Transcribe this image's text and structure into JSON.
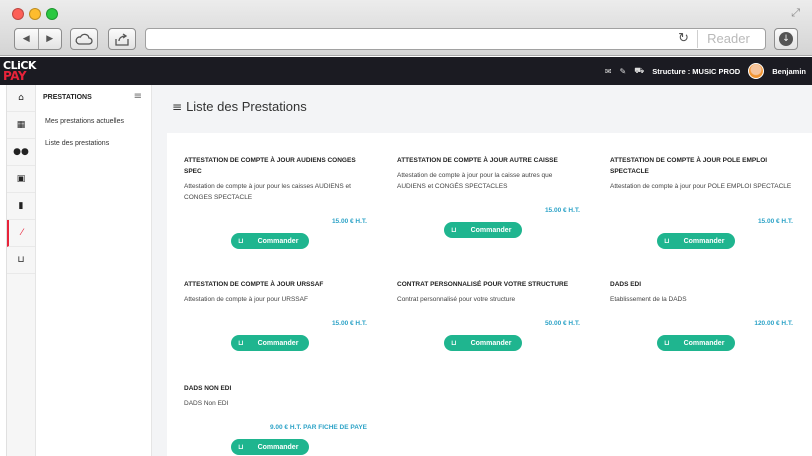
{
  "browser": {
    "reader_label": "Reader",
    "icons": [
      "back-icon",
      "forward-icon",
      "cloud-icon",
      "share-icon",
      "reload-icon",
      "download-icon",
      "fullscreen-icon"
    ]
  },
  "app": {
    "logo_line1": "CLiCK",
    "logo_line2": "PAY",
    "structure_label": "Structure : MUSIC PROD",
    "user_name": "Benjamin",
    "accent_color": "#e8233a",
    "button_color": "#1fb58f",
    "price_color": "#2da3c7"
  },
  "rail": {
    "items": [
      "home-icon",
      "calculator-icon",
      "users-icon",
      "money-icon",
      "document-icon",
      "wand-icon",
      "cart-icon"
    ]
  },
  "submenu": {
    "title": "PRESTATIONS",
    "items": [
      {
        "label": "Mes prestations actuelles"
      },
      {
        "label": "Liste des prestations"
      }
    ]
  },
  "main": {
    "title": "Liste des Prestations",
    "button_label": "Commander",
    "cards": [
      {
        "title": "ATTESTATION DE COMPTE À JOUR AUDIENS CONGES SPEC",
        "desc": "Attestation de compte à jour pour les caisses AUDIENS et CONGES SPECTACLE",
        "price": "15.00 € H.T."
      },
      {
        "title": "ATTESTATION DE COMPTE À JOUR AUTRE CAISSE",
        "desc": "Attestation de compte à jour pour la caisse autres que AUDIENS et CONGÉS SPECTACLES",
        "price": "15.00 € H.T."
      },
      {
        "title": "ATTESTATION DE COMPTE À JOUR POLE EMPLOI SPECTACLE",
        "desc": "Attestation de compte à jour pour POLE EMPLOI SPECTACLE",
        "price": "15.00 € H.T."
      },
      {
        "title": "ATTESTATION DE COMPTE À JOUR URSSAF",
        "desc": "Attestation de compte à jour pour URSSAF",
        "price": "15.00 € H.T."
      },
      {
        "title": "CONTRAT PERSONNALISÉ POUR VOTRE STRUCTURE",
        "desc": "Contrat personnalisé pour votre structure",
        "price": "50.00 € H.T."
      },
      {
        "title": "DADS EDI",
        "desc": "Etablissement de la DADS",
        "price": "120.00 € H.T."
      },
      {
        "title": "DADS NON EDI",
        "desc": "DADS Non EDI",
        "price": "9.00 € H.T. PAR FICHE DE PAYE"
      }
    ]
  }
}
